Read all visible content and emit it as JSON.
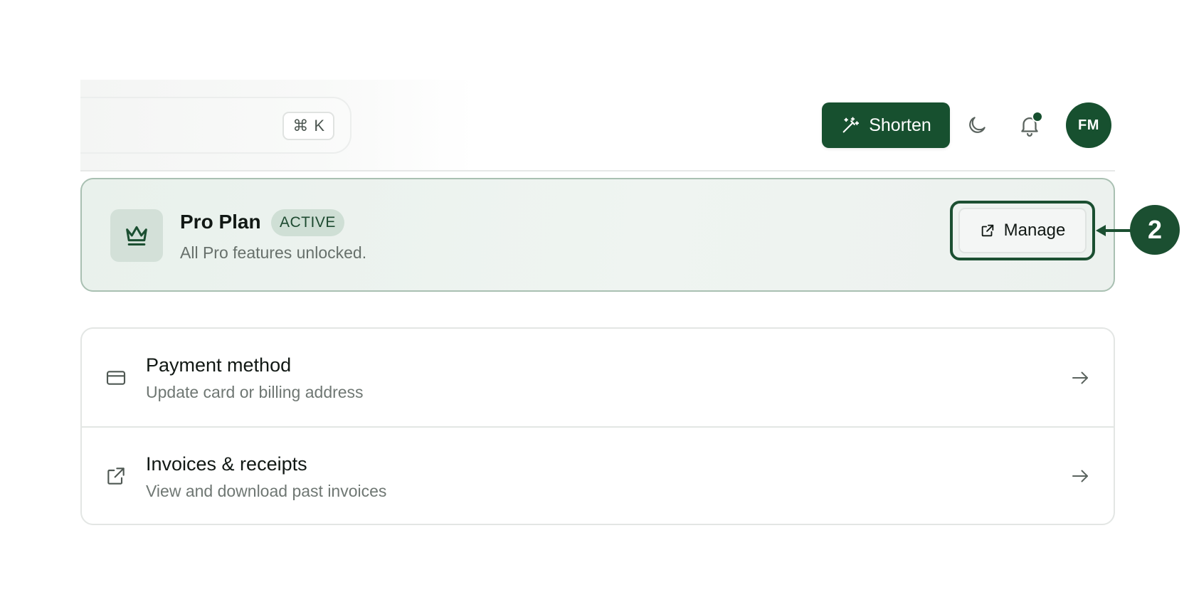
{
  "header": {
    "search": {
      "shortcut_symbol": "⌘",
      "shortcut_key": "K"
    },
    "shorten_label": "Shorten",
    "avatar_initials": "FM",
    "notifications_unread": true
  },
  "plan": {
    "title": "Pro Plan",
    "badge": "ACTIVE",
    "description": "All Pro features unlocked.",
    "manage_label": "Manage"
  },
  "annotation": {
    "step_number": "2"
  },
  "settings": {
    "items": [
      {
        "title": "Payment method",
        "subtitle": "Update card or billing address",
        "icon": "credit-card-icon"
      },
      {
        "title": "Invoices & receipts",
        "subtitle": "View and download past invoices",
        "icon": "external-link-icon"
      }
    ]
  },
  "colors": {
    "brand": "#17502f",
    "plan_card_bg": "#e9f1ec",
    "plan_card_border": "#a9c0b2",
    "badge_bg": "#cfdfd5",
    "muted_text": "#67706b"
  }
}
